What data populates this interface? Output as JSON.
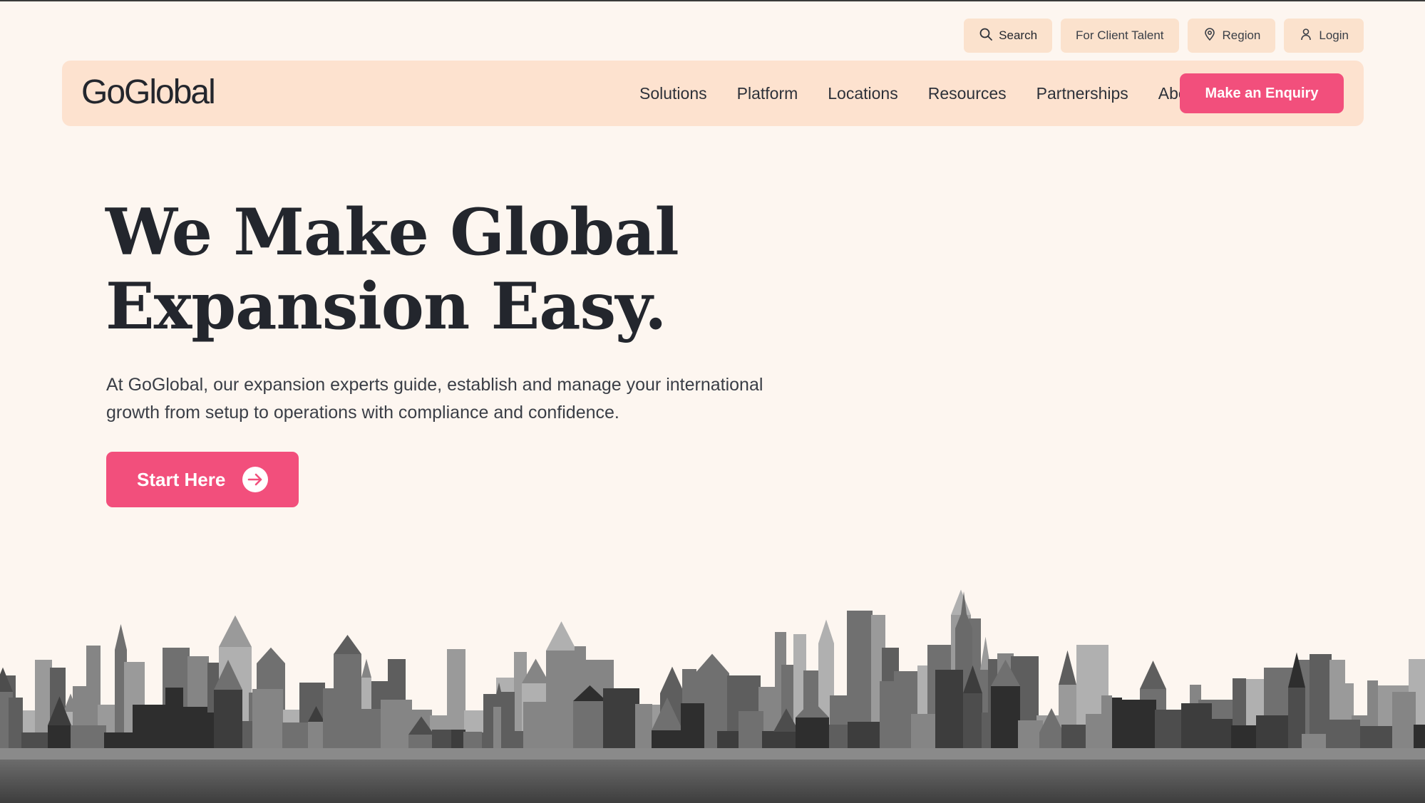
{
  "utility": {
    "search_label": "Search",
    "client_talent_label": "For Client Talent",
    "region_label": "Region",
    "login_label": "Login"
  },
  "brand": {
    "logo_text": "GoGlobal"
  },
  "nav": {
    "items": [
      {
        "label": "Solutions"
      },
      {
        "label": "Platform"
      },
      {
        "label": "Locations"
      },
      {
        "label": "Resources"
      },
      {
        "label": "Partnerships"
      },
      {
        "label": "About"
      }
    ],
    "cta_label": "Make an Enquiry"
  },
  "hero": {
    "title_line1": "We Make Global",
    "title_line2": "Expansion Easy.",
    "subtitle_line1": "At GoGlobal, our expansion experts guide, establish and manage your international",
    "subtitle_line2": "growth from setup to operations with compliance and confidence.",
    "cta_label": "Start Here"
  },
  "colors": {
    "background": "#fdf6f0",
    "nav_background": "#fde2cf",
    "accent": "#f24f7c",
    "text": "#23262d"
  },
  "icons": {
    "search": "search-icon",
    "region": "map-pin-icon",
    "login": "user-icon",
    "start": "arrow-right-circle-icon"
  }
}
